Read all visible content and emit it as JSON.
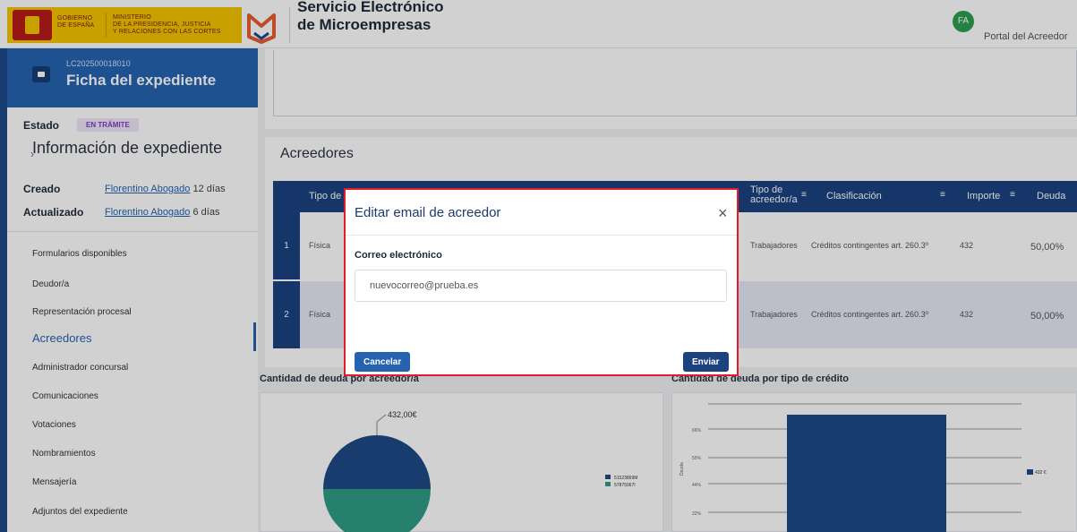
{
  "header": {
    "gov_line1": "GOBIERNO\nDE ESPAÑA",
    "gov_line2": "MINISTERIO\nDE LA PRESIDENCIA, JUSTICIA\nY RELACIONES CON LAS CORTES",
    "brand_line1": "Servicio Electrónico",
    "brand_line2": "de Microempresas",
    "avatar_initials": "FA",
    "portal_label": "Portal del Acreedor"
  },
  "sidebar": {
    "expediente_code": "LC202500018010",
    "expediente_title": "Ficha del expediente",
    "estado_label": "Estado",
    "estado_badge": "EN TRÁMITE",
    "info_title": "Información de expediente",
    "creado_label": "Creado",
    "creado_user": "Florentino Abogado",
    "creado_when": "12 días",
    "actualizado_label": "Actualizado",
    "actualizado_user": "Florentino Abogado",
    "actualizado_when": "6 días",
    "items": [
      {
        "label": "Formularios disponibles"
      },
      {
        "label": "Deudor/a"
      },
      {
        "label": "Representación procesal"
      },
      {
        "label": "Acreedores"
      },
      {
        "label": "Administrador concursal"
      },
      {
        "label": "Comunicaciones"
      },
      {
        "label": "Votaciones"
      },
      {
        "label": "Nombramientos"
      },
      {
        "label": "Mensajería"
      },
      {
        "label": "Adjuntos del expediente"
      }
    ]
  },
  "acreedores": {
    "title": "Acreedores",
    "columns": {
      "tipo": "Tipo de",
      "tipo_acreedor": "Tipo de\nacreedor/a",
      "clasificacion": "Clasificación",
      "importe": "Importe",
      "deuda": "Deuda"
    },
    "rows": [
      {
        "n": "1",
        "tipo": "Física",
        "tipo_acreedor": "Trabajadores",
        "clasificacion": "Créditos contingentes art. 260.3º",
        "importe": "432",
        "deuda": "50,00%"
      },
      {
        "n": "2",
        "tipo": "Física",
        "tipo_acreedor": "Trabajadores",
        "clasificacion": "Créditos contingentes art. 260.3º",
        "importe": "432",
        "deuda": "50,00%"
      }
    ]
  },
  "charts": {
    "pie_title": "Cantidad de deuda por acreedor/a",
    "pie_label": "432,00€",
    "pie_legend": [
      "51523869M",
      "57875067I"
    ],
    "bar_title": "Cantidad de deuda por tipo de crédito",
    "bar_ylabel": "Deuda",
    "bar_ticks": [
      "66%",
      "55%",
      "44%",
      "22%"
    ],
    "bar_legend": "432 €"
  },
  "chart_data": [
    {
      "type": "pie",
      "title": "Cantidad de deuda por acreedor/a",
      "categories": [
        "51523869M",
        "57875067I"
      ],
      "values": [
        432,
        432
      ]
    },
    {
      "type": "bar",
      "title": "Cantidad de deuda por tipo de crédito",
      "ylabel": "Deuda",
      "series": [
        {
          "name": "432 €",
          "values": [
            100
          ]
        }
      ]
    }
  ],
  "modal": {
    "title": "Editar email de acreedor",
    "field_label": "Correo electrónico",
    "field_value": "nuevocorreo@prueba.es",
    "cancel_label": "Cancelar",
    "send_label": "Enviar"
  },
  "colors": {
    "primary": "#2563b0",
    "dark_blue": "#1c4280",
    "highlight_border": "#e11d2c",
    "pie_top": "#1d4a86",
    "pie_bottom": "#2f9d86"
  }
}
